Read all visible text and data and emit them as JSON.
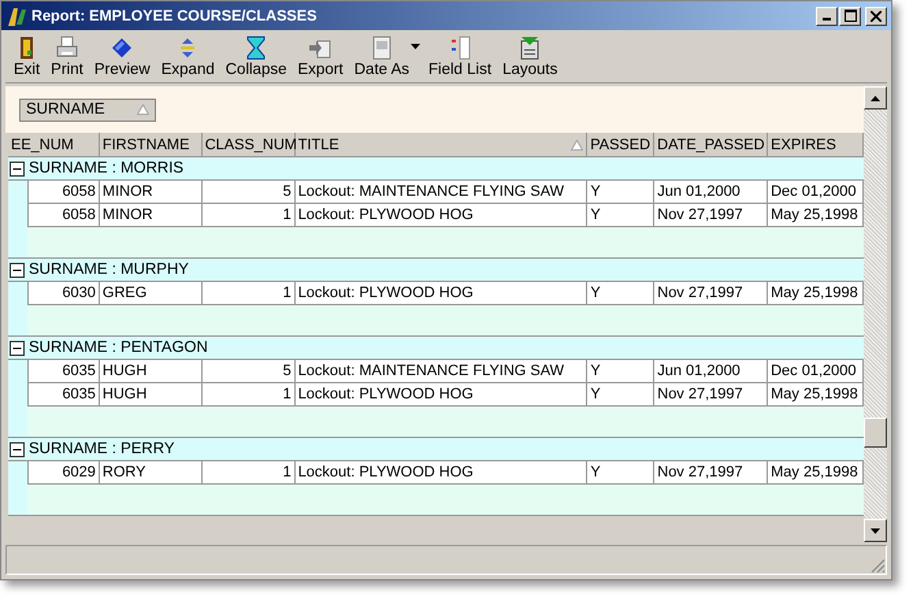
{
  "window": {
    "title": "Report: EMPLOYEE COURSE/CLASSES"
  },
  "toolbar": [
    {
      "label": "Exit",
      "dropdown": false
    },
    {
      "label": "Print",
      "dropdown": false
    },
    {
      "label": "Preview",
      "dropdown": false
    },
    {
      "label": "Expand",
      "dropdown": false
    },
    {
      "label": "Collapse",
      "dropdown": false
    },
    {
      "label": "Export",
      "dropdown": false
    },
    {
      "label": "Date As",
      "dropdown": true
    },
    {
      "label": "Field List",
      "dropdown": false
    },
    {
      "label": "Layouts",
      "dropdown": false
    }
  ],
  "group_panel": {
    "chips": [
      {
        "label": "SURNAME",
        "sorted": true
      }
    ]
  },
  "table": {
    "columns": [
      {
        "label": "EE_NUM",
        "sorted": false
      },
      {
        "label": "FIRSTNAME",
        "sorted": false
      },
      {
        "label": "CLASS_NUM",
        "sorted": false
      },
      {
        "label": "TITLE",
        "sorted": true
      },
      {
        "label": "PASSED",
        "sorted": false
      },
      {
        "label": "DATE_PASSED",
        "sorted": false
      },
      {
        "label": "EXPIRES",
        "sorted": false
      }
    ],
    "groups": [
      {
        "label": "SURNAME : MORRIS",
        "expanded": true,
        "rows": [
          [
            "6058",
            "MINOR",
            "5",
            "Lockout: MAINTENANCE FLYING SAW",
            "Y",
            "Jun 01,2000",
            "Dec 01,2000"
          ],
          [
            "6058",
            "MINOR",
            "1",
            "Lockout: PLYWOOD HOG",
            "Y",
            "Nov 27,1997",
            "May 25,1998"
          ]
        ]
      },
      {
        "label": "SURNAME : MURPHY",
        "expanded": true,
        "rows": [
          [
            "6030",
            "GREG",
            "1",
            "Lockout: PLYWOOD HOG",
            "Y",
            "Nov 27,1997",
            "May 25,1998"
          ]
        ]
      },
      {
        "label": "SURNAME : PENTAGON",
        "expanded": true,
        "rows": [
          [
            "6035",
            "HUGH",
            "5",
            "Lockout: MAINTENANCE FLYING SAW",
            "Y",
            "Jun 01,2000",
            "Dec 01,2000"
          ],
          [
            "6035",
            "HUGH",
            "1",
            "Lockout: PLYWOOD HOG",
            "Y",
            "Nov 27,1997",
            "May 25,1998"
          ]
        ]
      },
      {
        "label": "SURNAME : PERRY",
        "expanded": true,
        "rows": [
          [
            "6029",
            "RORY",
            "1",
            "Lockout: PLYWOOD HOG",
            "Y",
            "Nov 27,1997",
            "May 25,1998"
          ]
        ]
      }
    ]
  }
}
